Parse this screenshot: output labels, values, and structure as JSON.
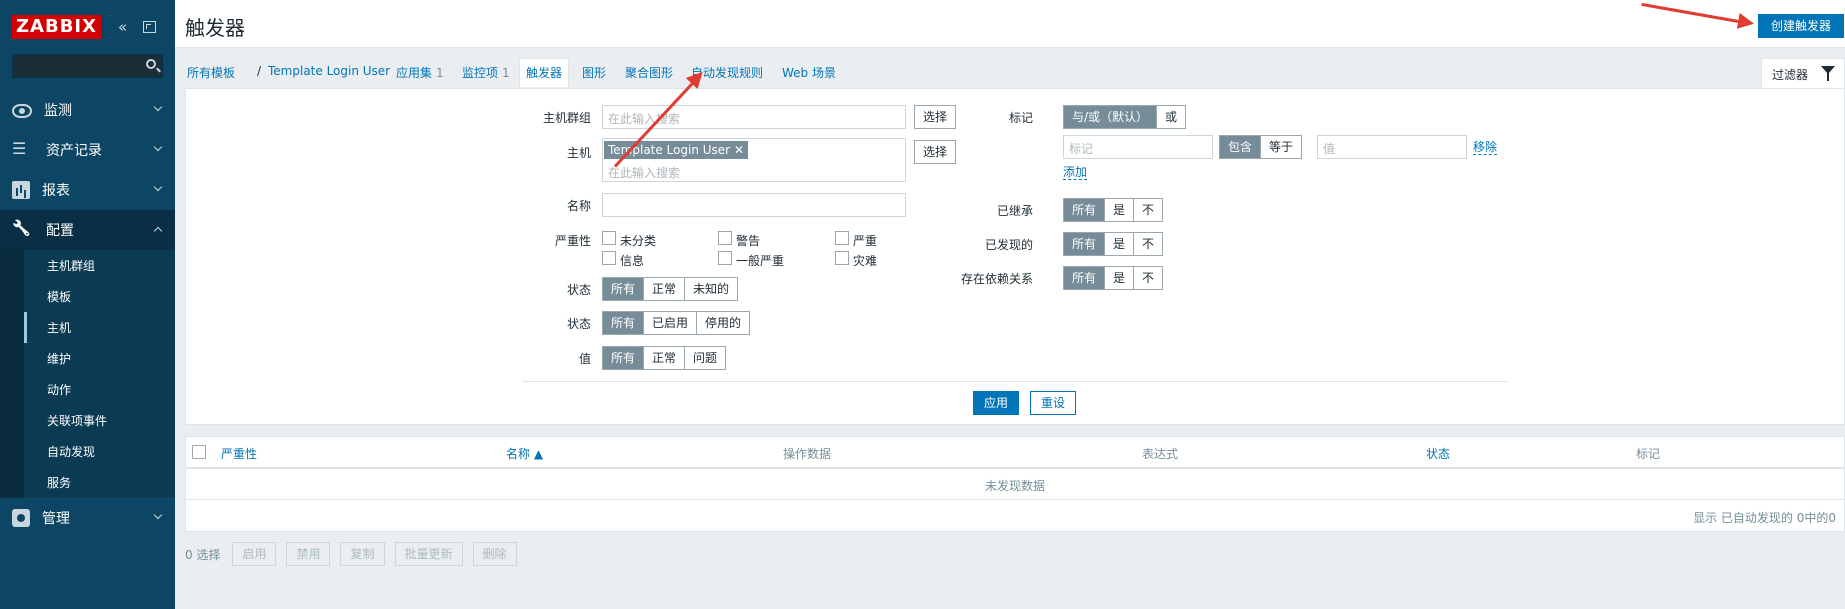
{
  "app": {
    "logo": "ZABBIX"
  },
  "sidebar": {
    "search_placeholder": "",
    "menu": [
      {
        "label": "监测",
        "icon": "eye-icon"
      },
      {
        "label": "资产记录",
        "icon": "list-icon"
      },
      {
        "label": "报表",
        "icon": "chart-icon"
      },
      {
        "label": "配置",
        "icon": "wrench-icon"
      },
      {
        "label": "管理",
        "icon": "gear-icon"
      }
    ],
    "submenu": [
      "主机群组",
      "模板",
      "主机",
      "维护",
      "动作",
      "关联项事件",
      "自动发现",
      "服务"
    ],
    "selected_submenu": "主机"
  },
  "header": {
    "title": "触发器",
    "create_button": "创建触发器"
  },
  "breadcrumb": {
    "all_templates": "所有模板",
    "separator": "/",
    "template": "Template Login User",
    "tabs": [
      {
        "label": "应用集",
        "count": "1"
      },
      {
        "label": "监控项",
        "count": "1"
      },
      {
        "label": "触发器",
        "count": ""
      },
      {
        "label": "图形",
        "count": ""
      },
      {
        "label": "聚合图形",
        "count": ""
      },
      {
        "label": "自动发现规则",
        "count": ""
      },
      {
        "label": "Web 场景",
        "count": ""
      }
    ],
    "active_tab": "触发器"
  },
  "filter": {
    "tab_label": "过滤器",
    "host_groups_label": "主机群组",
    "host_groups_placeholder": "在此输入搜索",
    "select_label": "选择",
    "host_label": "主机",
    "host_chip": "Template Login User",
    "host_placeholder": "在此输入搜索",
    "name_label": "名称",
    "name_value": "",
    "severity_label": "严重性",
    "severities": [
      "未分类",
      "警告",
      "严重",
      "信息",
      "一般严重",
      "灾难"
    ],
    "state_label": "状态",
    "state_options": [
      "所有",
      "正常",
      "未知的"
    ],
    "status_label": "状态",
    "status_options": [
      "所有",
      "已启用",
      "停用的"
    ],
    "value_label": "值",
    "value_options": [
      "所有",
      "正常",
      "问题"
    ],
    "tags_label": "标记",
    "tags_mode_options": [
      "与/或（默认）",
      "或"
    ],
    "tag_placeholder": "标记",
    "tag_op_options": [
      "包含",
      "等于"
    ],
    "tag_value_placeholder": "值",
    "remove_label": "移除",
    "add_label": "添加",
    "inherited_label": "已继承",
    "discovered_label": "已发现的",
    "dependencies_label": "存在依赖关系",
    "tri_options": [
      "所有",
      "是",
      "不"
    ],
    "apply_label": "应用",
    "reset_label": "重设"
  },
  "table": {
    "columns": [
      "严重性",
      "名称 ▲",
      "操作数据",
      "表达式",
      "状态",
      "标记"
    ],
    "no_data": "未发现数据",
    "footer": "显示 已自动发现的 0中的0"
  },
  "actions": {
    "selected": "0 选择",
    "buttons": [
      "启用",
      "禁用",
      "复制",
      "批量更新",
      "删除"
    ]
  },
  "colors": {
    "sidebar_bg": "#0d4664",
    "accent": "#0275b8",
    "logo_red": "#d40000",
    "annotation_arrow": "#e03c31"
  }
}
